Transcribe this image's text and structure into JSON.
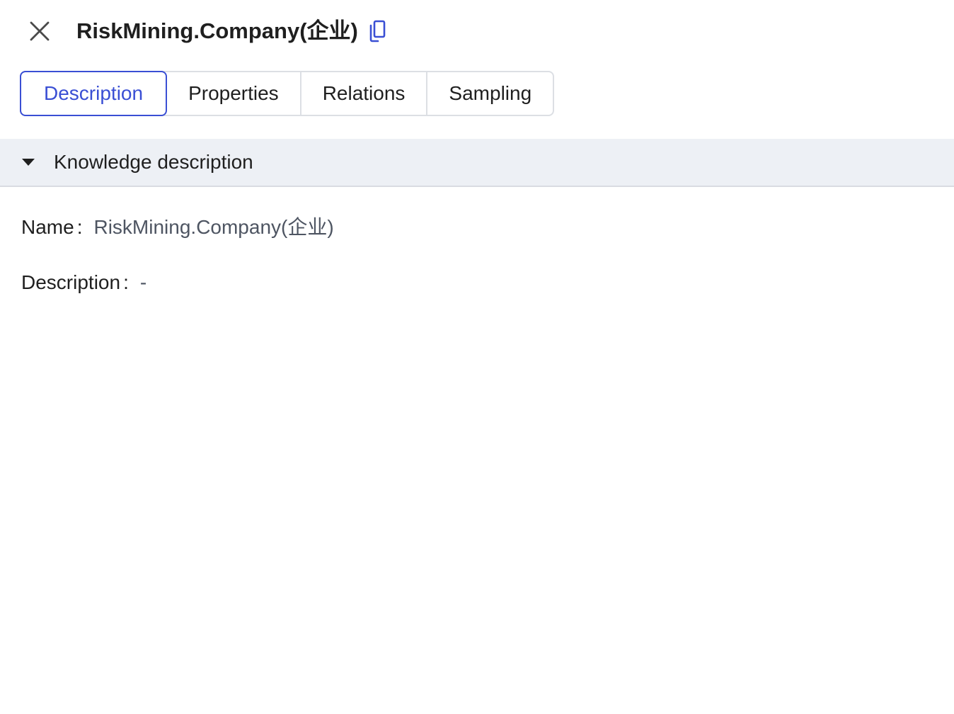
{
  "header": {
    "title": "RiskMining.Company(企业)",
    "close_icon": "close-icon",
    "copy_icon": "copy-icon",
    "accent_color": "#3a4fd4"
  },
  "tabs": [
    {
      "label": "Description",
      "active": true
    },
    {
      "label": "Properties",
      "active": false
    },
    {
      "label": "Relations",
      "active": false
    },
    {
      "label": "Sampling",
      "active": false
    }
  ],
  "section": {
    "title": "Knowledge description",
    "expanded": true,
    "caret_icon": "caret-down-icon",
    "fields": [
      {
        "label": "Name",
        "colon": ":",
        "value": "RiskMining.Company(企业)"
      },
      {
        "label": "Description",
        "colon": ":",
        "value": "-"
      }
    ]
  }
}
